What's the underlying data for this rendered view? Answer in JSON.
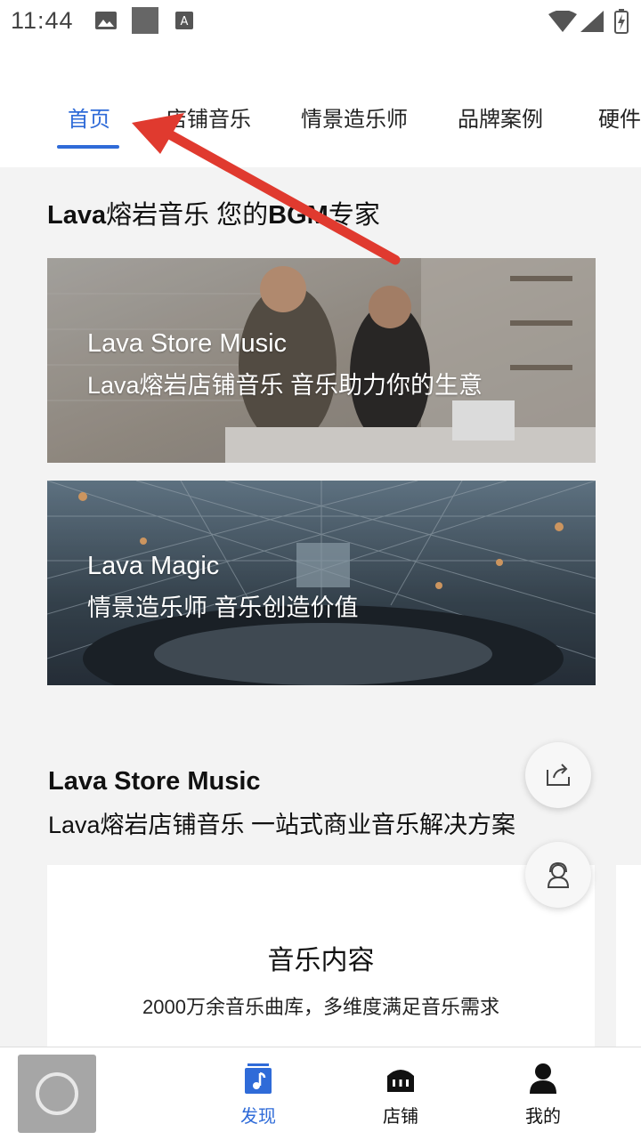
{
  "status_bar": {
    "time": "11:44"
  },
  "tabs": [
    {
      "label": "首页",
      "active": true
    },
    {
      "label": "店铺音乐"
    },
    {
      "label": "情景造乐师"
    },
    {
      "label": "品牌案例"
    },
    {
      "label": "硬件"
    }
  ],
  "headline": {
    "brand": "Lava",
    "text": "熔岩音乐 您的",
    "bold_part": "BGM",
    "tail": "专家"
  },
  "banners": [
    {
      "title": "Lava Store Music",
      "subtitle": "Lava熔岩店铺音乐 音乐助力你的生意"
    },
    {
      "title": "Lava Magic",
      "subtitle": "情景造乐师 音乐创造价值"
    }
  ],
  "section": {
    "title": "Lava Store Music",
    "subtitle": "Lava熔岩店铺音乐 一站式商业音乐解决方案"
  },
  "card": {
    "title": "音乐内容",
    "description": "2000万余音乐曲库，多维度满足音乐需求"
  },
  "fabs": [
    {
      "icon": "share-icon"
    },
    {
      "icon": "customer-service-icon"
    }
  ],
  "bottom_nav": [
    {
      "label": "发现",
      "icon": "music-note-icon",
      "active": true
    },
    {
      "label": "店铺",
      "icon": "store-icon"
    },
    {
      "label": "我的",
      "icon": "person-icon"
    }
  ],
  "colors": {
    "accent": "#2f6bd8",
    "annotation_arrow": "#e03a2f"
  }
}
